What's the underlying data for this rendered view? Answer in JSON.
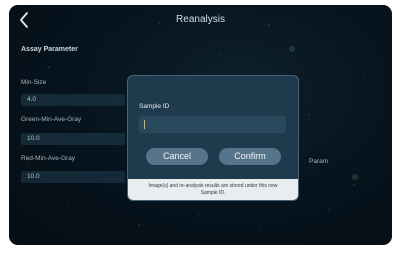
{
  "header": {
    "title": "Reanalysis"
  },
  "assay": {
    "section_title": "Assay Parameter",
    "fields": [
      {
        "label": "Min-Size",
        "value": "4.0"
      },
      {
        "label": "Green-Min-Ave-Gray",
        "value": "10.0"
      },
      {
        "label": "Red-Min-Ave-Gray",
        "value": "10.0"
      }
    ],
    "side_label_fragment": "Param"
  },
  "dialog": {
    "label": "Sample ID",
    "input_value": "",
    "cancel_label": "Cancel",
    "confirm_label": "Confirm",
    "note_line1": "Image(s) and re-analysis results are stored under this new",
    "note_line2": "Sample ID."
  },
  "colors": {
    "background": "#0b1d2a",
    "dialog_bg": "#1e3a4c",
    "button": "#57758a",
    "caret": "#e0b24a",
    "note_bg": "#e9edf0"
  }
}
